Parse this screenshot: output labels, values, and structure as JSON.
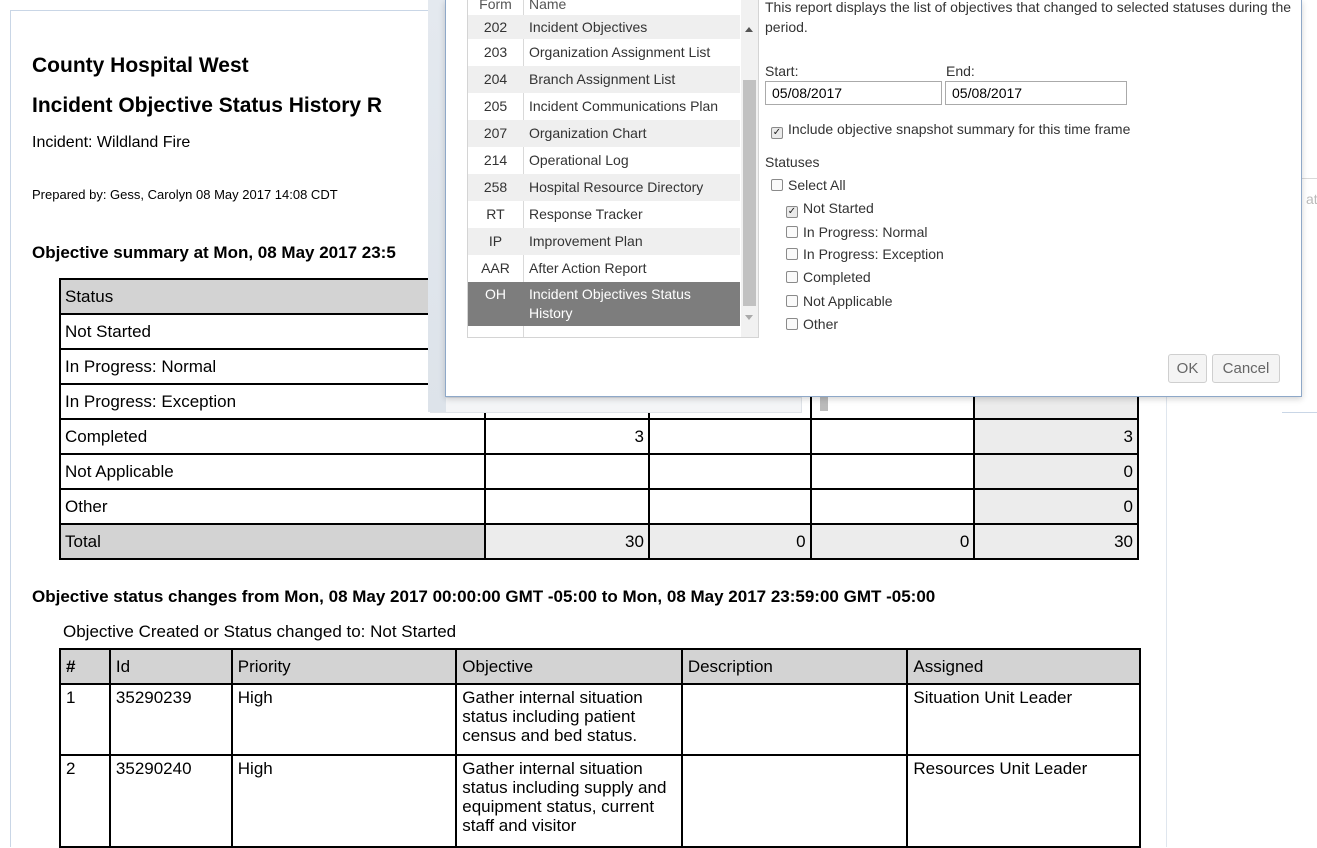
{
  "report": {
    "hospital": "County Hospital West",
    "title": "Incident Objective Status History R",
    "incident": "Incident: Wildland Fire",
    "prepared": "Prepared by: Gess, Carolyn 08 May 2017 14:08 CDT",
    "summary_heading": "Objective summary at Mon, 08 May 2017 23:5",
    "summary_header": "Status",
    "summary_rows": [
      {
        "status": "Not Started",
        "c1": "",
        "c2": "",
        "c3": "",
        "total": ""
      },
      {
        "status": "In Progress: Normal",
        "c1": "",
        "c2": "",
        "c3": "",
        "total": ""
      },
      {
        "status": "In Progress: Exception",
        "c1": "",
        "c2": "",
        "c3": "",
        "total": ""
      },
      {
        "status": "Completed",
        "c1": "3",
        "c2": "",
        "c3": "",
        "total": "3"
      },
      {
        "status": "Not Applicable",
        "c1": "",
        "c2": "",
        "c3": "",
        "total": "0"
      },
      {
        "status": "Other",
        "c1": "",
        "c2": "",
        "c3": "",
        "total": "0"
      }
    ],
    "summary_total": {
      "status": "Total",
      "c1": "30",
      "c2": "0",
      "c3": "0",
      "total": "30"
    },
    "changes_heading": "Objective status changes from Mon, 08 May 2017 00:00:00 GMT -05:00 to Mon, 08 May 2017 23:59:00 GMT -05:00",
    "changes_subheading": "Objective Created or Status changed to: Not Started",
    "changes_columns": [
      "#",
      "Id",
      "Priority",
      "Objective",
      "Description",
      "Assigned"
    ],
    "changes_rows": [
      {
        "num": "1",
        "id": "35290239",
        "priority": "High",
        "objective": "Gather internal situation status including patient census and bed status.",
        "description": "",
        "assigned": "Situation Unit Leader"
      },
      {
        "num": "2",
        "id": "35290240",
        "priority": "High",
        "objective": "Gather internal situation status including supply and equipment status, current staff and visitor",
        "description": "",
        "assigned": "Resources Unit Leader"
      }
    ]
  },
  "dialog": {
    "form_header": "Form",
    "name_header": "Name",
    "forms": [
      {
        "form": "202",
        "name": "Incident Objectives"
      },
      {
        "form": "203",
        "name": "Organization Assignment List"
      },
      {
        "form": "204",
        "name": "Branch Assignment List"
      },
      {
        "form": "205",
        "name": "Incident Communications Plan"
      },
      {
        "form": "207",
        "name": "Organization Chart"
      },
      {
        "form": "214",
        "name": "Operational Log"
      },
      {
        "form": "258",
        "name": "Hospital Resource Directory"
      },
      {
        "form": "RT",
        "name": "Response Tracker"
      },
      {
        "form": "IP",
        "name": "Improvement Plan"
      },
      {
        "form": "AAR",
        "name": "After Action Report"
      },
      {
        "form": "OH",
        "name": "Incident Objectives Status History"
      }
    ],
    "description": "This report displays the list of objectives that changed to selected statuses during the period.",
    "start_label": "Start:",
    "end_label": "End:",
    "start_value": "05/08/2017",
    "end_value": "05/08/2017",
    "snapshot_label": "Include objective snapshot summary for this time frame",
    "snapshot_checked": true,
    "statuses_label": "Statuses",
    "select_all_label": "Select All",
    "statuses": [
      {
        "label": "Not Started",
        "checked": true
      },
      {
        "label": "In Progress: Normal",
        "checked": false
      },
      {
        "label": "In Progress: Exception",
        "checked": false
      },
      {
        "label": "Completed",
        "checked": false
      },
      {
        "label": "Not Applicable",
        "checked": false
      },
      {
        "label": "Other",
        "checked": false
      }
    ],
    "ok_label": "OK",
    "cancel_label": "Cancel"
  },
  "edge_text": "at"
}
